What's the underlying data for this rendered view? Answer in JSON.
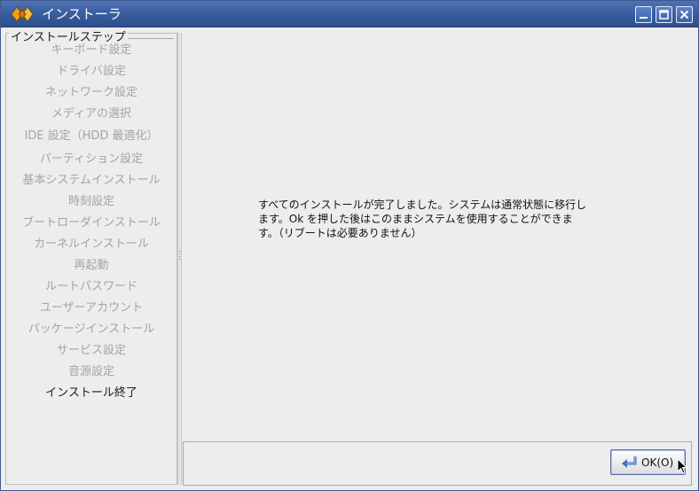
{
  "window": {
    "title": "インストーラ"
  },
  "sidebar": {
    "group_title": "インストールステップ",
    "steps": [
      "キーボード設定",
      "ドライバ設定",
      "ネットワーク設定",
      "メディアの選択",
      "IDE 設定（HDD 最適化）",
      "パーティション設定",
      "基本システムインストール",
      "時刻設定",
      "ブートローダインストール",
      "カーネルインストール",
      "再起動",
      "ルートパスワード",
      "ユーザーアカウント",
      "パッケージインストール",
      "サービス設定",
      "音源設定",
      "インストール終了"
    ],
    "current_step": "インストール終了"
  },
  "main": {
    "message": "すべてのインストールが完了しました。システムは通常状態に移行し\nます。Ok を押した後はこのままシステムを使用することができま\nす。（リブートは必要ありません）"
  },
  "buttons": {
    "ok_label": "OK(O)"
  },
  "colors": {
    "titlebar": "#3a5e9f",
    "inactive_step": "#a4a4a4",
    "active_step": "#1a1a1a"
  }
}
